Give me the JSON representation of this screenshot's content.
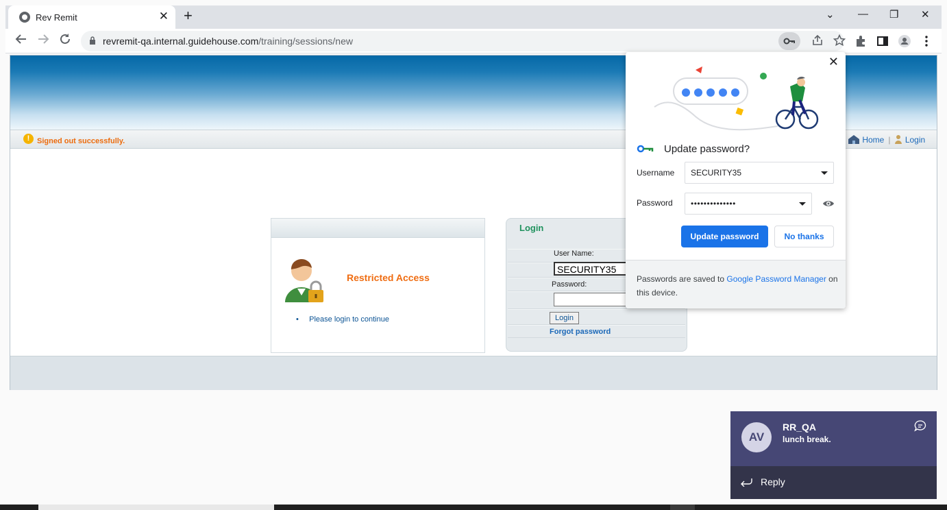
{
  "browser": {
    "tab_title": "Rev Remit",
    "tab_close": "✕",
    "new_tab": "+",
    "url_host": "revremit-qa.internal.guidehouse.com",
    "url_path": "/training/sessions/new",
    "window_controls": {
      "minimize": "—",
      "maximize": "❐",
      "close": "✕",
      "tabsearch": "⌄"
    }
  },
  "page": {
    "status_message": "Signed out successfully.",
    "warn_glyph": "!",
    "links": {
      "home": "Home",
      "login": "Login"
    },
    "restricted": {
      "title": "Restricted Access",
      "bullet": "Please login to continue"
    },
    "login": {
      "heading": "Login",
      "username_label": "User Name:",
      "username_value": "SECURITY35",
      "password_label": "Password:",
      "button": "Login",
      "forgot": "Forgot password"
    }
  },
  "password_bubble": {
    "title": "Update password?",
    "username_label": "Username",
    "username_value": "SECURITY35",
    "password_label": "Password",
    "password_value": "••••••••••••••",
    "update_button": "Update password",
    "no_thanks_button": "No thanks",
    "footer_prefix": "Passwords are saved to ",
    "footer_link": "Google Password Manager",
    "footer_suffix": " on this device."
  },
  "notification": {
    "avatar_initials": "AV",
    "sender": "RR_QA",
    "message": "lunch break.",
    "reply_label": "Reply"
  },
  "colors": {
    "accent_blue": "#1a73e8",
    "status_orange": "#ec6c0e",
    "login_green": "#20925e",
    "teams_purple": "#464775"
  }
}
